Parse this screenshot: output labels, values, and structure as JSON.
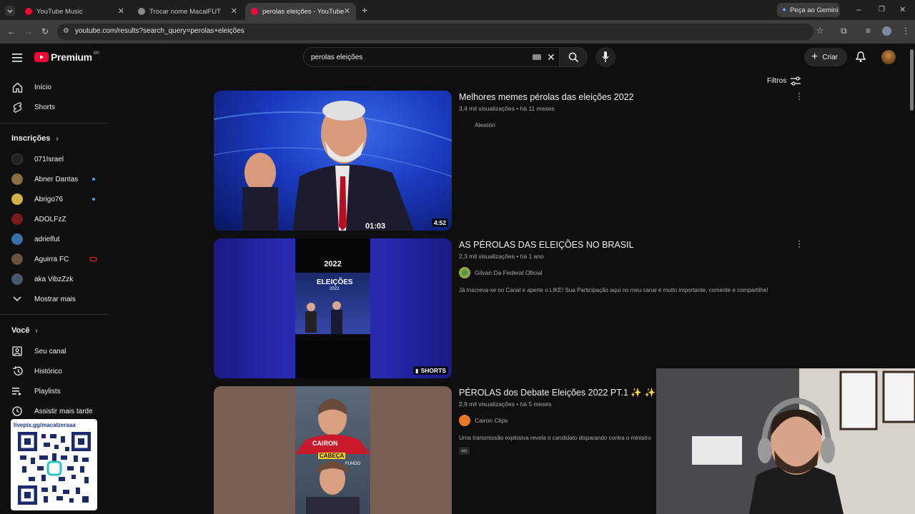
{
  "browser": {
    "tabs": [
      {
        "title": "YouTube Music",
        "active": false,
        "favicon_color": "#ff0033"
      },
      {
        "title": "Trocar nome MacalFUT",
        "active": false,
        "favicon_color": "#8a8a8a"
      },
      {
        "title": "perolas eleições - YouTube",
        "active": true,
        "favicon_color": "#ff0033"
      }
    ],
    "url": "youtube.com/results?search_query=perolas+eleições",
    "gemini_label": "Peça ao Gemini"
  },
  "youtube": {
    "logo_text": "Premium",
    "logo_region": "BR",
    "search_value": "perolas eleições",
    "create_label": "Criar",
    "filters_label": "Filtros",
    "sidebar": {
      "main": [
        {
          "label": "Início",
          "icon": "home-icon"
        },
        {
          "label": "Shorts",
          "icon": "shorts-icon"
        }
      ],
      "subscriptions_header": "Inscrições",
      "subscriptions": [
        {
          "label": "071Israel",
          "color": "#222",
          "dot": false
        },
        {
          "label": "Abner Dantas",
          "color": "#8d6e43",
          "dot": true
        },
        {
          "label": "Abrigo76",
          "color": "#d4b14a",
          "dot": true
        },
        {
          "label": "ADOLFzZ",
          "color": "#7a1a1a",
          "dot": false
        },
        {
          "label": "adrielfut",
          "color": "#3a6ea8",
          "dot": false
        },
        {
          "label": "Aguirra FC",
          "color": "#6b5040",
          "dot": false,
          "live": true
        },
        {
          "label": "aka VibzZzk",
          "color": "#4a5a6a",
          "dot": false
        }
      ],
      "show_more": "Mostrar mais",
      "you_header": "Você",
      "you": [
        {
          "label": "Seu canal",
          "icon": "channel-icon"
        },
        {
          "label": "Histórico",
          "icon": "history-icon"
        },
        {
          "label": "Playlists",
          "icon": "playlists-icon"
        },
        {
          "label": "Assistir mais tarde",
          "icon": "watch-later-icon"
        }
      ]
    },
    "overlay_qr_text": "livepix.gg/macalzeraaa",
    "results": [
      {
        "title": "Melhores memes pérolas das eleições 2022",
        "meta": "3,4 mil visualizações • há 11 meses",
        "channel": "Aleatóri",
        "description": "",
        "duration": "4:52",
        "thumb_overlay": "01:03",
        "badge": ""
      },
      {
        "title": "AS PÉROLAS DAS ELEIÇÕES NO BRASIL",
        "meta": "2,3 mil visualizações • há 1 ano",
        "channel": "Gilvan Da Federal Oficial",
        "description": "Já Inscreva-se no Canal e aperte o LIKE! Sua Participação aqui no meu canal é muito importante, comente e compartilhe!",
        "duration": "",
        "badge": "SHORTS",
        "thumb_year": "2022",
        "thumb_label": "ELEIÇÕES",
        "thumb_sub": "2022"
      },
      {
        "title": "PÉROLAS dos Debate Eleições 2022 PT.1 ✨ ✨ ✨",
        "meta": "2,9 mil visualizações • há 5 meses",
        "channel": "Cairon Clips",
        "description": "Uma transmissão explosiva revela o candidato disparando contra o ministro",
        "tag": "4K",
        "thumb_brand": "CAIRON",
        "thumb_caption_1": "CABEÇA",
        "thumb_caption_2": "FUNDO"
      }
    ]
  }
}
